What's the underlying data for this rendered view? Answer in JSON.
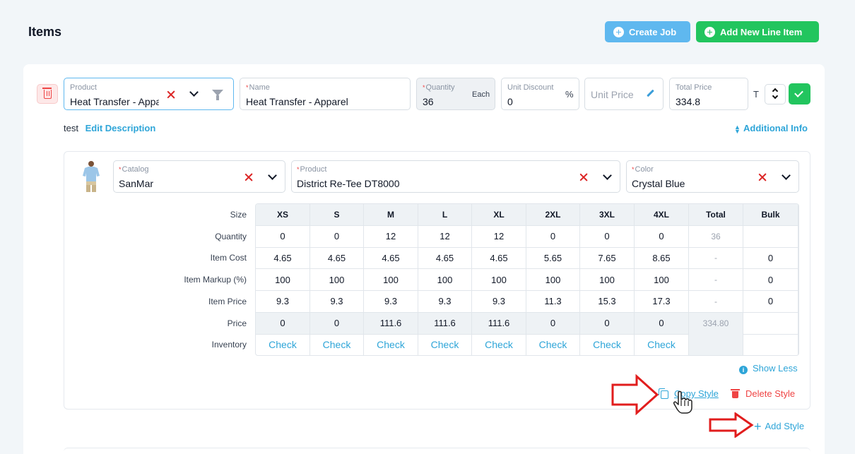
{
  "page": {
    "title": "Items"
  },
  "header_actions": {
    "create_job": "Create Job",
    "add_line_item": "Add New Line Item"
  },
  "colors": {
    "primary_light": "#5fb8ef",
    "success": "#22c55e",
    "danger": "#ef4444",
    "link": "#2ea5d8"
  },
  "line_item": {
    "product": {
      "label": "Product",
      "value": "Heat Transfer - Appa"
    },
    "name": {
      "label": "Name",
      "value": "Heat Transfer - Apparel"
    },
    "quantity": {
      "label": "Quantity",
      "value": "36",
      "unit": "Each"
    },
    "unit_discount": {
      "label": "Unit Discount",
      "value": "0",
      "suffix": "%"
    },
    "unit_price": {
      "placeholder": "Unit Price"
    },
    "total_price": {
      "label": "Total Price",
      "value": "334.8"
    },
    "tax_letter": "T",
    "description": "test",
    "edit_description": "Edit Description",
    "additional_info": "Additional Info"
  },
  "style": {
    "catalog": {
      "label": "Catalog",
      "value": "SanMar"
    },
    "product": {
      "label": "Product",
      "value": "District Re-Tee DT8000"
    },
    "color": {
      "label": "Color",
      "value": "Crystal Blue"
    },
    "row_labels": [
      "Size",
      "Quantity",
      "Item Cost",
      "Item Markup (%)",
      "Item Price",
      "Price",
      "Inventory"
    ],
    "sizes": [
      "XS",
      "S",
      "M",
      "L",
      "XL",
      "2XL",
      "3XL",
      "4XL"
    ],
    "total_header": "Total",
    "bulk_header": "Bulk",
    "quantity": [
      "0",
      "0",
      "12",
      "12",
      "12",
      "0",
      "0",
      "0"
    ],
    "item_cost": [
      "4.65",
      "4.65",
      "4.65",
      "4.65",
      "4.65",
      "5.65",
      "7.65",
      "8.65"
    ],
    "item_markup": [
      "100",
      "100",
      "100",
      "100",
      "100",
      "100",
      "100",
      "100"
    ],
    "item_price": [
      "9.3",
      "9.3",
      "9.3",
      "9.3",
      "9.3",
      "11.3",
      "15.3",
      "17.3"
    ],
    "price": [
      "0",
      "0",
      "111.6",
      "111.6",
      "111.6",
      "0",
      "0",
      "0"
    ],
    "inventory_label": "Check",
    "totals": {
      "quantity": "36",
      "item_cost": "-",
      "item_markup": "-",
      "item_price": "-",
      "price": "334.80"
    },
    "bulk": {
      "item_cost": "0",
      "item_markup": "0",
      "item_price": "0"
    },
    "show_less": "Show Less",
    "copy_style": "Copy Style",
    "delete_style": "Delete Style"
  },
  "add_style": "Add Style"
}
